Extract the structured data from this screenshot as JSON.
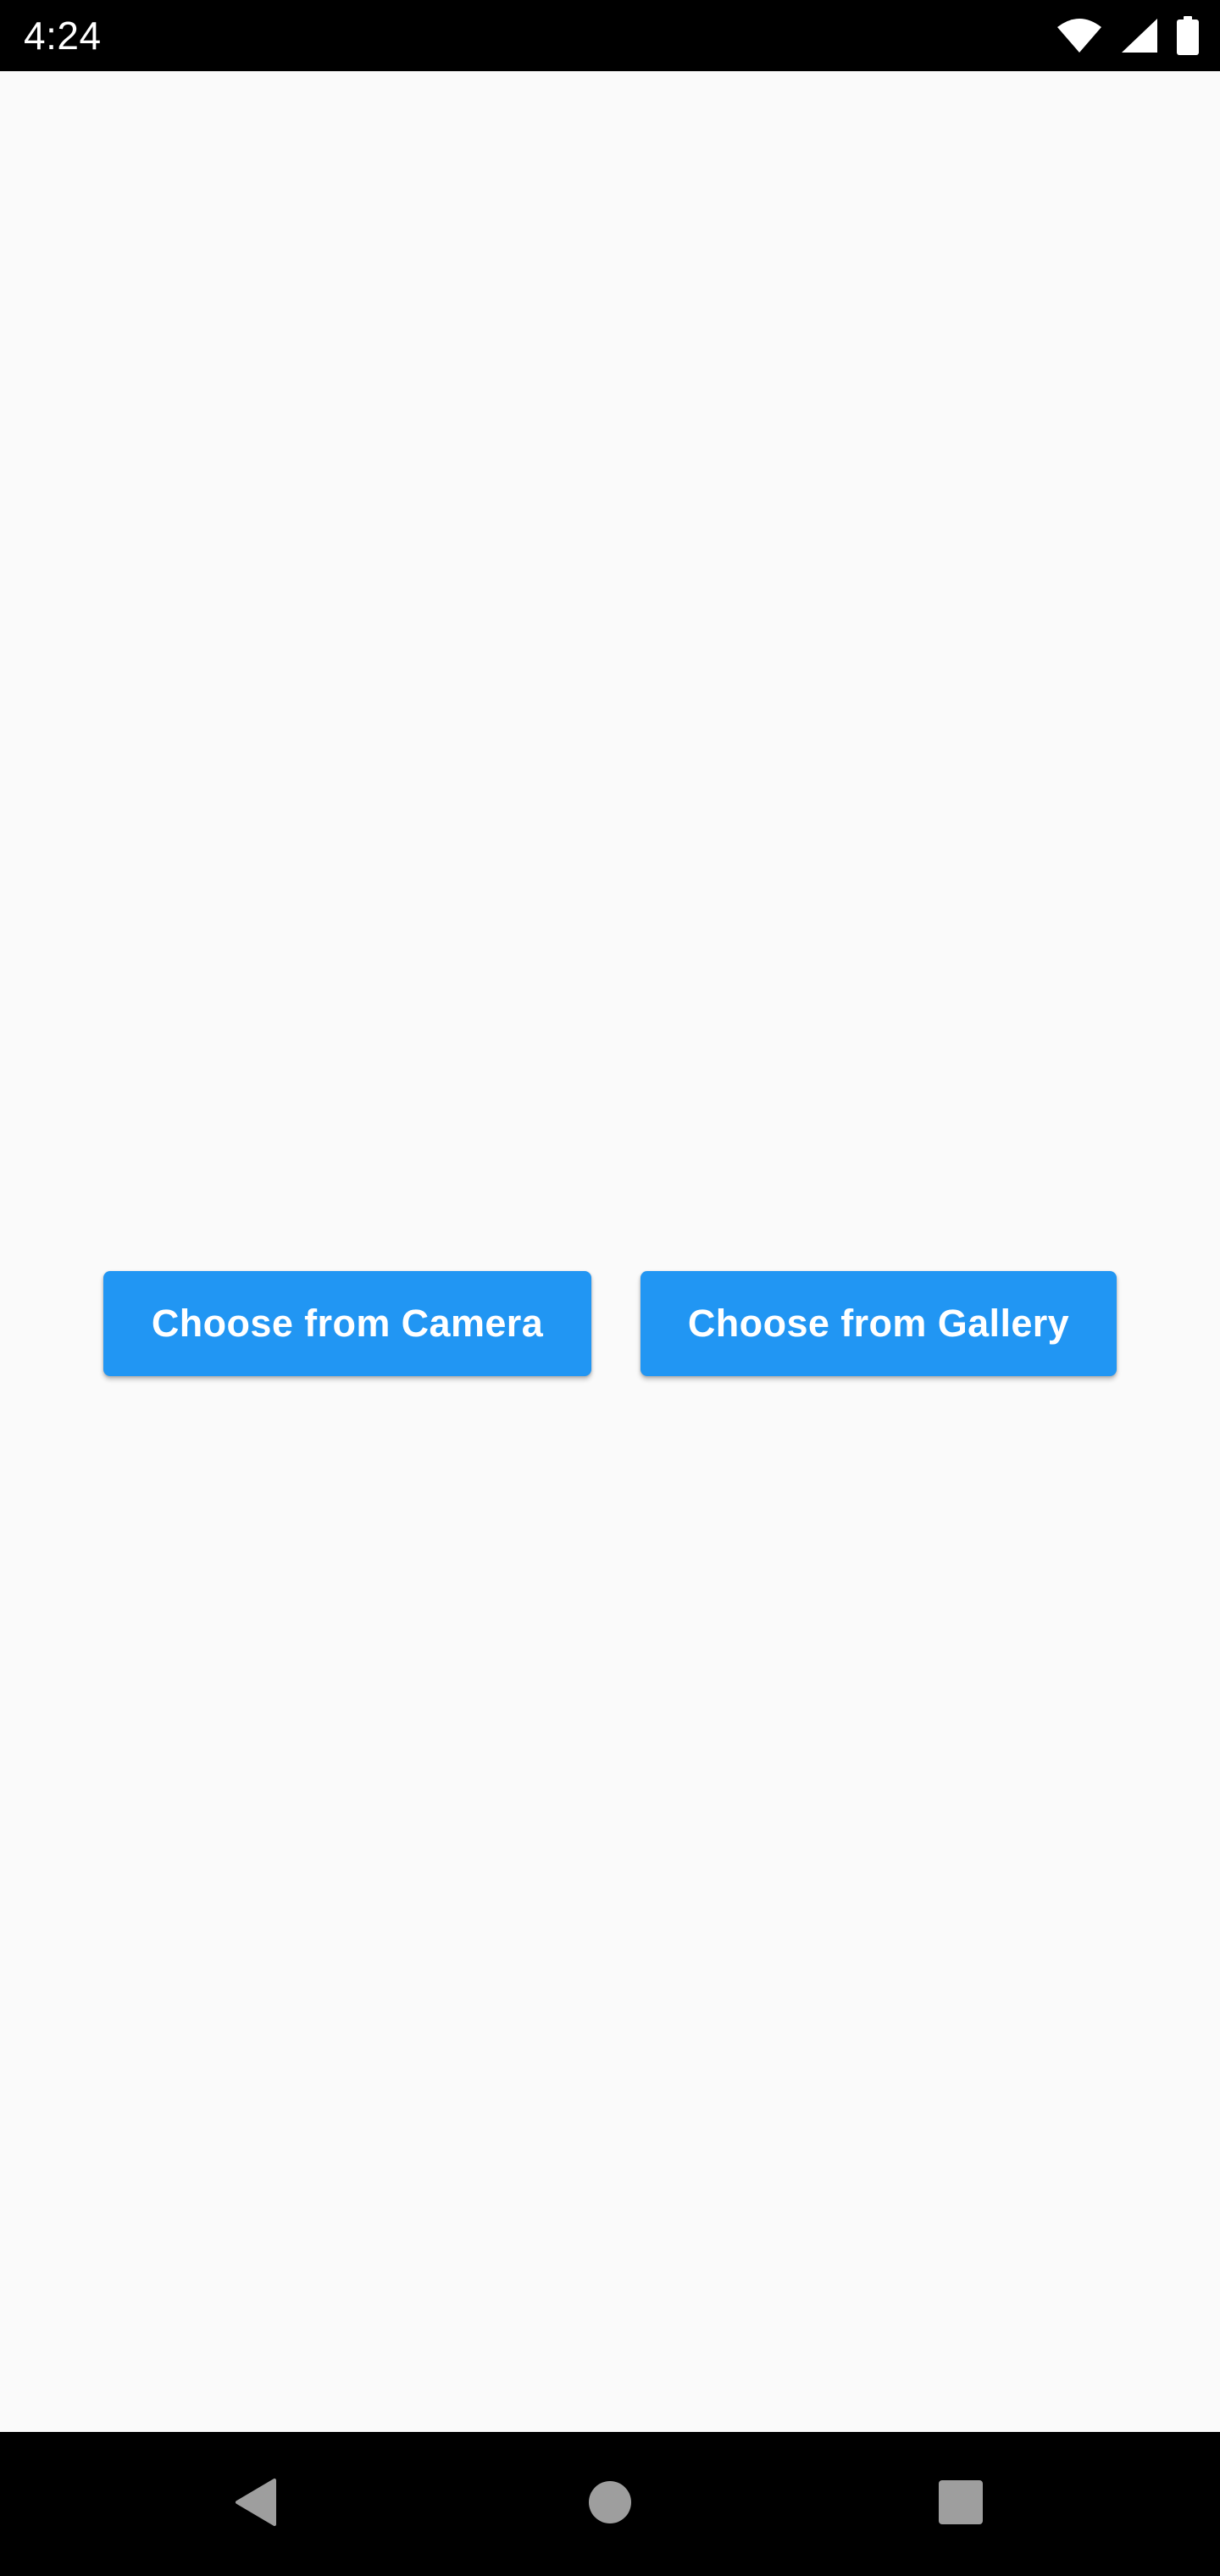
{
  "status_bar": {
    "time": "4:24",
    "icons": [
      "wifi-icon",
      "cellular-signal-icon",
      "battery-icon"
    ]
  },
  "main": {
    "camera_button_label": "Choose from Camera",
    "gallery_button_label": "Choose from Gallery"
  },
  "nav_bar": {
    "icons": [
      "back-icon",
      "home-icon",
      "recents-icon"
    ]
  },
  "colors": {
    "accent": "#2196f3",
    "background": "#fafafa",
    "system_bars": "#000000",
    "nav_icons": "#9e9e9e"
  }
}
